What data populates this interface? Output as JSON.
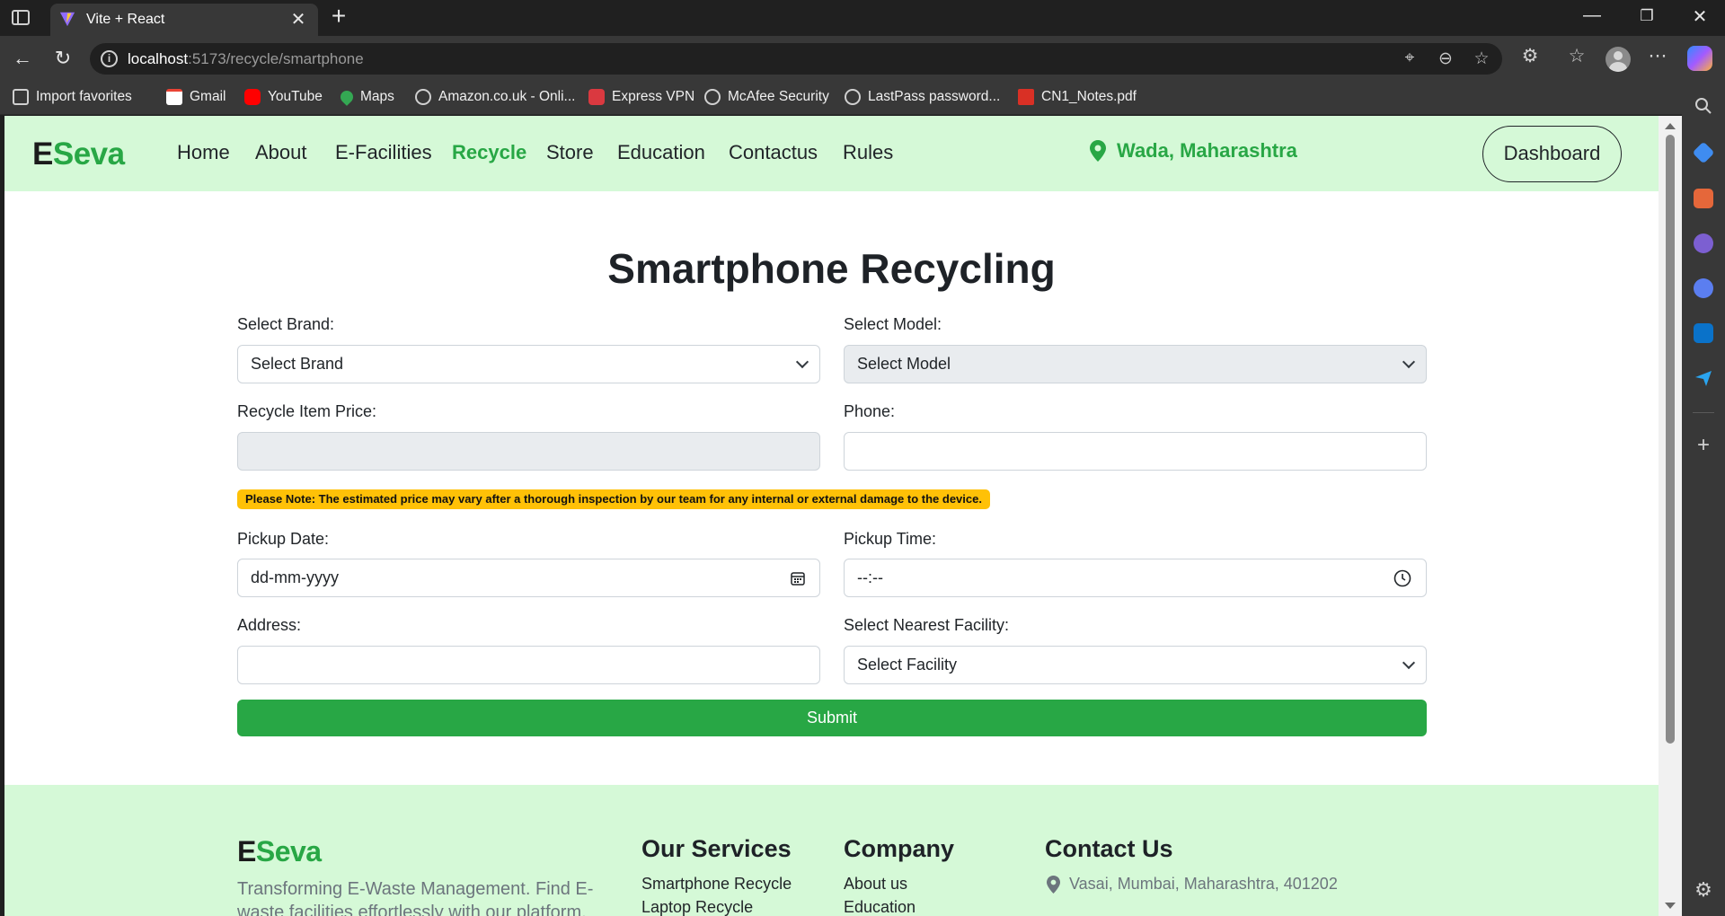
{
  "browser": {
    "tab_title": "Vite + React",
    "url_host": "localhost",
    "url_rest": ":5173/recycle/smartphone",
    "bookmarks": [
      "Import favorites",
      "Gmail",
      "YouTube",
      "Maps",
      "Amazon.co.uk - Onli...",
      "Express VPN",
      "McAfee Security",
      "LastPass password...",
      "CN1_Notes.pdf"
    ]
  },
  "site": {
    "logo_e": "E",
    "logo_rest": "Seva",
    "nav": [
      "Home",
      "About",
      "E-Facilities",
      "Recycle",
      "Store",
      "Education",
      "Contactus",
      "Rules"
    ],
    "location": "Wada, Maharashtra",
    "dashboard_label": "Dashboard"
  },
  "form": {
    "title": "Smartphone Recycling",
    "brand_label": "Select Brand:",
    "brand_value": "Select Brand",
    "model_label": "Select Model:",
    "model_value": "Select Model",
    "price_label": "Recycle Item Price:",
    "price_value": "",
    "phone_label": "Phone:",
    "phone_value": "",
    "note": "Please Note: The estimated price may vary after a thorough inspection by our team for any internal or external damage to the device.",
    "date_label": "Pickup Date:",
    "date_placeholder": "dd-mm-yyyy",
    "time_label": "Pickup Time:",
    "time_placeholder": "--:--",
    "address_label": "Address:",
    "address_value": "",
    "facility_label": "Select Nearest Facility:",
    "facility_value": "Select Facility",
    "submit_label": "Submit"
  },
  "footer": {
    "logo_e": "E",
    "logo_rest": "Seva",
    "tagline_1": "Transforming E-Waste Management. Find E-",
    "tagline_2": "waste facilities effortlessly with our platform.",
    "services_title": "Our Services",
    "services": [
      "Smartphone Recycle",
      "Laptop Recycle"
    ],
    "company_title": "Company",
    "company": [
      "About us",
      "Education"
    ],
    "contact_title": "Contact Us",
    "contact_address": "Vasai, Mumbai, Maharashtra, 401202"
  },
  "colors": {
    "brand_green": "#28a745",
    "nav_bg": "#d5f9d7",
    "note_yellow": "#ffc107"
  }
}
